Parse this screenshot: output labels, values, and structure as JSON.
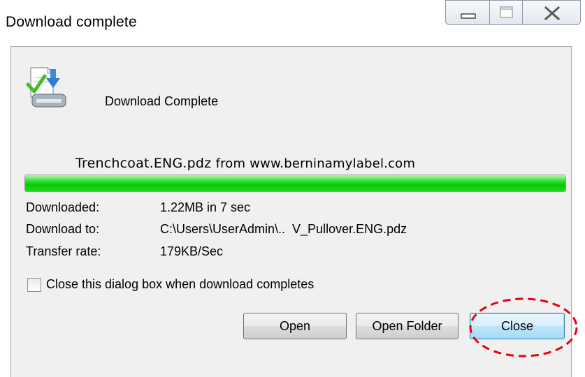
{
  "window": {
    "title": "Download complete",
    "controls": [
      "minimize-icon",
      "maximize-icon",
      "close-icon"
    ]
  },
  "header": {
    "icon": "download-complete-icon",
    "status_label": "Download Complete"
  },
  "file": {
    "name": "Trenchcoat.ENG.pdz",
    "source": "from www.berninamylabel.com"
  },
  "progress": {
    "fraction": 1.0,
    "color": "#1ad01a"
  },
  "details": {
    "downloaded": {
      "label": "Downloaded:",
      "value": "1.22MB in 7 sec"
    },
    "download_to": {
      "label": "Download to:",
      "value": "C:\\Users\\UserAdmin\\..  V_Pullover.ENG.pdz"
    },
    "transfer_rate": {
      "label": "Transfer rate:",
      "value": "179KB/Sec"
    }
  },
  "options": {
    "close_when_done": {
      "label": "Close this dialog box when download completes",
      "checked": false
    }
  },
  "buttons": {
    "open": "Open",
    "open_folder": "Open Folder",
    "close": "Close"
  },
  "colors": {
    "dialog_background": "#f0f0f0",
    "focus_button": "#bee6fd",
    "annotation": "#e8000b"
  }
}
